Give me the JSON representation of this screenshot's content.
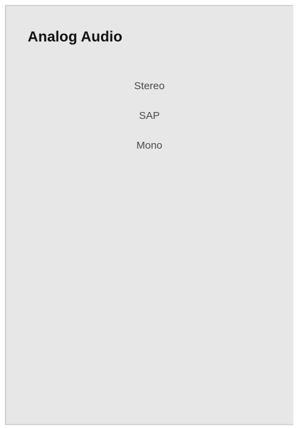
{
  "window": {
    "title": "Analog Audio"
  },
  "options": [
    {
      "label": "Stereo"
    },
    {
      "label": "SAP"
    },
    {
      "label": "Mono"
    }
  ],
  "colors": {
    "panel_background": "#e7e7e7",
    "title_text": "#111111",
    "option_text": "#4a4a4a"
  }
}
